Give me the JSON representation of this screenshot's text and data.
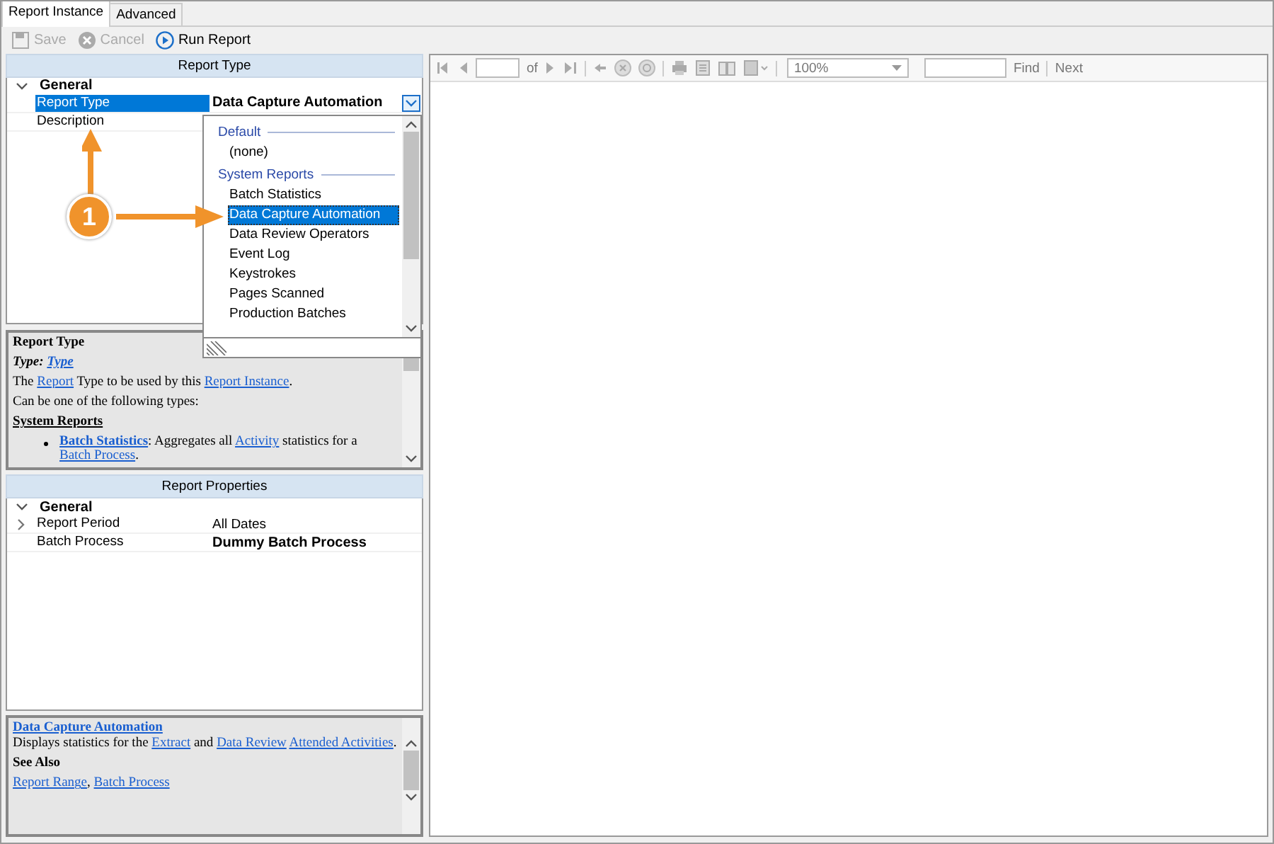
{
  "tabs": [
    {
      "label": "Report Instance",
      "selected": true
    },
    {
      "label": "Advanced",
      "selected": false
    }
  ],
  "toolbar": [
    {
      "label": "Save",
      "disabled": true
    },
    {
      "label": "Cancel",
      "disabled": true
    },
    {
      "label": "Run Report",
      "disabled": false
    }
  ],
  "report_type_grid": {
    "header": "Report Type",
    "category": "General",
    "rows": [
      {
        "name": "Report Type",
        "value": "Data Capture Automation",
        "selected": true,
        "bold": true
      },
      {
        "name": "Description",
        "selected": false
      }
    ]
  },
  "dropdown": {
    "items": [
      {
        "kind": "header",
        "label": "Default"
      },
      {
        "kind": "item",
        "label": "(none)",
        "selected": false
      },
      {
        "kind": "header",
        "label": "System Reports"
      },
      {
        "kind": "item",
        "label": "Batch Statistics",
        "selected": false
      },
      {
        "kind": "item",
        "label": "Data Capture Automation",
        "selected": true
      },
      {
        "kind": "item",
        "label": "Data Review Operators",
        "selected": false
      },
      {
        "kind": "item",
        "label": "Event Log",
        "selected": false
      },
      {
        "kind": "item",
        "label": "Keystrokes",
        "selected": false
      },
      {
        "kind": "item",
        "label": "Pages Scanned",
        "selected": false
      },
      {
        "kind": "item",
        "label": "Production Batches",
        "selected": false
      }
    ]
  },
  "callout": {
    "label": "1"
  },
  "help_top": {
    "blocks": [
      {
        "kind": "title",
        "parts": [
          {
            "text": "Report Type",
            "link": false
          }
        ]
      },
      {
        "kind": "type",
        "parts": [
          {
            "text": "Type: ",
            "link": false
          },
          {
            "text": "Type",
            "link": true
          }
        ]
      },
      {
        "kind": "para",
        "parts": [
          {
            "text": "The ",
            "link": false
          },
          {
            "text": "Report",
            "link": true
          },
          {
            "text": " Type to be used by this ",
            "link": false
          },
          {
            "text": "Report Instance",
            "link": true
          },
          {
            "text": ".",
            "link": false
          }
        ]
      },
      {
        "kind": "para",
        "parts": [
          {
            "text": "Can be one of the following types:",
            "link": false
          }
        ]
      },
      {
        "kind": "section",
        "parts": [
          {
            "text": "System Reports",
            "link": false
          }
        ]
      },
      {
        "kind": "bullet",
        "parts": [
          {
            "text": "Batch Statistics",
            "link": true
          },
          {
            "text": ": Aggregates all ",
            "link": false
          },
          {
            "text": "Activity",
            "link": true
          },
          {
            "text": " statistics for a ",
            "link": false
          },
          {
            "text": "Batch Process",
            "link": true
          },
          {
            "text": ".",
            "link": false
          }
        ]
      }
    ]
  },
  "properties_grid": {
    "header": "Report Properties",
    "category": "General",
    "rows": [
      {
        "name": "Report Period",
        "value": "All Dates",
        "expandable": true,
        "bold": false
      },
      {
        "name": "Batch Process",
        "value": "Dummy Batch Process",
        "expandable": false,
        "bold": true
      }
    ]
  },
  "help_bottom": {
    "blocks": [
      {
        "kind": "titlelink",
        "parts": [
          {
            "text": "Data Capture Automation",
            "link": true
          }
        ]
      },
      {
        "kind": "para",
        "parts": [
          {
            "text": "Displays statistics for the ",
            "link": false
          },
          {
            "text": "Extract",
            "link": true
          },
          {
            "text": " and ",
            "link": false
          },
          {
            "text": "Data Review",
            "link": true
          },
          {
            "text": "Attended Activities",
            "link": true
          },
          {
            "text": ".",
            "link": false
          }
        ]
      },
      {
        "kind": "title",
        "parts": [
          {
            "text": "See Also",
            "link": false
          }
        ]
      },
      {
        "kind": "para",
        "parts": [
          {
            "text": "Report Range",
            "link": true
          },
          {
            "text": ", ",
            "link": false
          },
          {
            "text": "Batch Process",
            "link": true
          }
        ]
      }
    ]
  },
  "viewer_toolbar": {
    "of_label": "of",
    "zoom": "100%",
    "find": "Find",
    "next": "Next"
  }
}
